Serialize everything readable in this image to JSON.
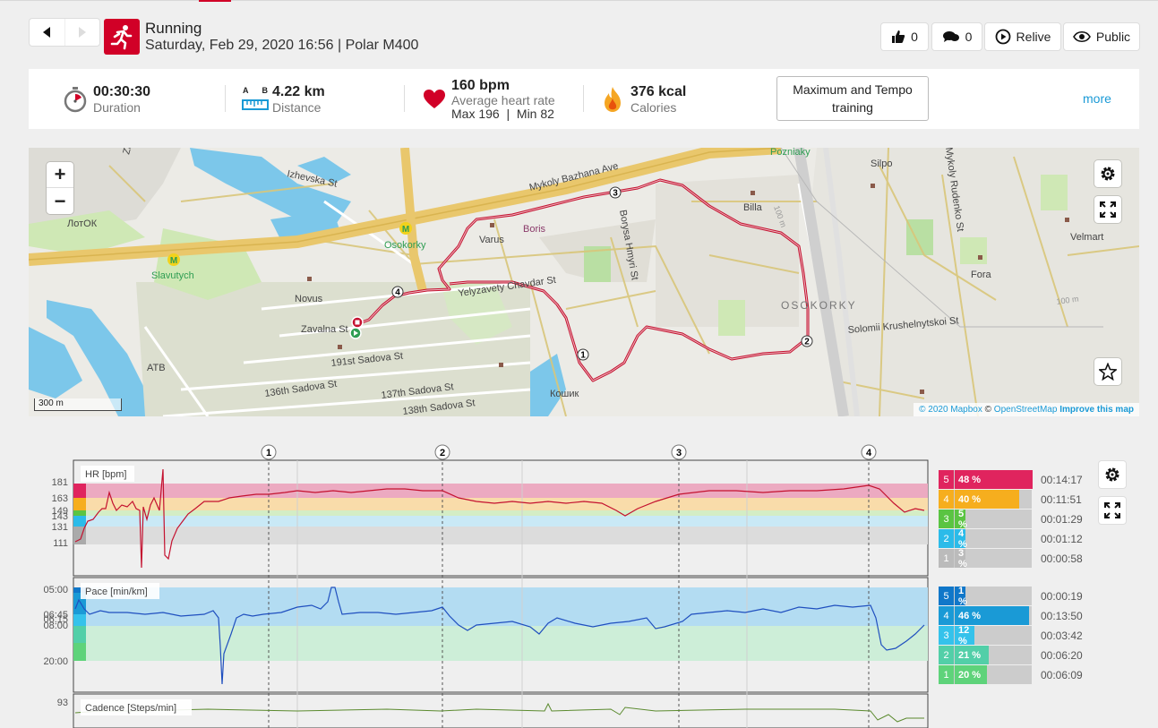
{
  "header": {
    "sport": "Running",
    "subtitle": "Saturday, Feb 29, 2020 16:56 | Polar M400",
    "sport_icon": "running-person-icon",
    "accent": "#d10027"
  },
  "actions": {
    "likes": "0",
    "comments": "0",
    "relive": "Relive",
    "visibility": "Public"
  },
  "summary": {
    "duration": {
      "value": "00:30:30",
      "label": "Duration"
    },
    "distance": {
      "value": "4.22 km",
      "label": "Distance",
      "a": "A",
      "b": "B"
    },
    "heart": {
      "value": "160 bpm",
      "label": "Average heart rate",
      "max_label": "Max",
      "max": "196",
      "min_label": "Min",
      "min": "82"
    },
    "calories": {
      "value": "376 kcal",
      "label": "Calories"
    },
    "training": "Maximum and Tempo training",
    "more": "more"
  },
  "map": {
    "labels": {
      "izhevska": "Izhevska St",
      "bazhana": "Mykoly Bazhana Ave",
      "pozniaky": "Pozniaky",
      "silpo": "Silpo",
      "rudenko": "Mykoly Rudenko St",
      "zarichna": "Zarichna",
      "lotok": "ЛотОК",
      "osokorky_metro": "Osokorky",
      "slavutych": "Slavutych",
      "varus": "Varus",
      "boris": "Boris",
      "hmyria": "Borysa Hmyri St",
      "billa": "Billa",
      "velmart": "Velmart",
      "fora": "Fora",
      "novus": "Novus",
      "zavalna": "Zavalna St",
      "chavdar": "Yelyzavety Chavdar St",
      "osokorky_area": "OSOKORKY",
      "krushelnytskoi": "Solomii Krushelnytskoi St",
      "atb": "ATB",
      "sadova191": "191st Sadova St",
      "sadova136": "136th Sadova St",
      "sadova137": "137th Sadova St",
      "sadova138": "138th Sadova St",
      "koshyk": "Кошик",
      "m100a": "100 m",
      "m100b": "100 m"
    },
    "scale": "300 m",
    "attribution": {
      "mapbox": "© 2020 Mapbox",
      "copy": "©",
      "osm": "OpenStreetMap",
      "improve": "Improve this map"
    },
    "laps": [
      "1",
      "2",
      "3",
      "4"
    ]
  },
  "charts": {
    "laps": [
      "1",
      "2",
      "3",
      "4"
    ],
    "hr": {
      "label": "HR [bpm]",
      "ticks": [
        "181",
        "163",
        "149",
        "143",
        "131",
        "111"
      ]
    },
    "pace": {
      "label": "Pace [min/km]",
      "ticks": [
        "05:00",
        "06:45",
        "06:15",
        "08:00",
        "20:00"
      ]
    },
    "cadence": {
      "label": "Cadence [Steps/min]",
      "ticks": [
        "93"
      ]
    },
    "hr_zones": [
      {
        "zone": "5",
        "percent": "48 %",
        "time": "00:14:17",
        "color": "#e0245e",
        "fraction": 0.48
      },
      {
        "zone": "4",
        "percent": "40 %",
        "time": "00:11:51",
        "color": "#f6ae1e",
        "fraction": 0.4
      },
      {
        "zone": "3",
        "percent": "5 %",
        "time": "00:01:29",
        "color": "#5ac442",
        "fraction": 0.05
      },
      {
        "zone": "2",
        "percent": "4 %",
        "time": "00:01:12",
        "color": "#2bbbe9",
        "fraction": 0.04
      },
      {
        "zone": "1",
        "percent": "3 %",
        "time": "00:00:58",
        "color": "#bbbbbb",
        "fraction": 0.03
      }
    ],
    "pace_zones": [
      {
        "zone": "5",
        "percent": "1 %",
        "time": "00:00:19",
        "color": "#1077c9",
        "fraction": 0.01
      },
      {
        "zone": "4",
        "percent": "46 %",
        "time": "00:13:50",
        "color": "#1a9ad6",
        "fraction": 0.46
      },
      {
        "zone": "3",
        "percent": "12 %",
        "time": "00:03:42",
        "color": "#34c2eb",
        "fraction": 0.12
      },
      {
        "zone": "2",
        "percent": "21 %",
        "time": "00:06:20",
        "color": "#52cfa8",
        "fraction": 0.21
      },
      {
        "zone": "1",
        "percent": "20 %",
        "time": "00:06:09",
        "color": "#5ed37a",
        "fraction": 0.2
      }
    ]
  }
}
